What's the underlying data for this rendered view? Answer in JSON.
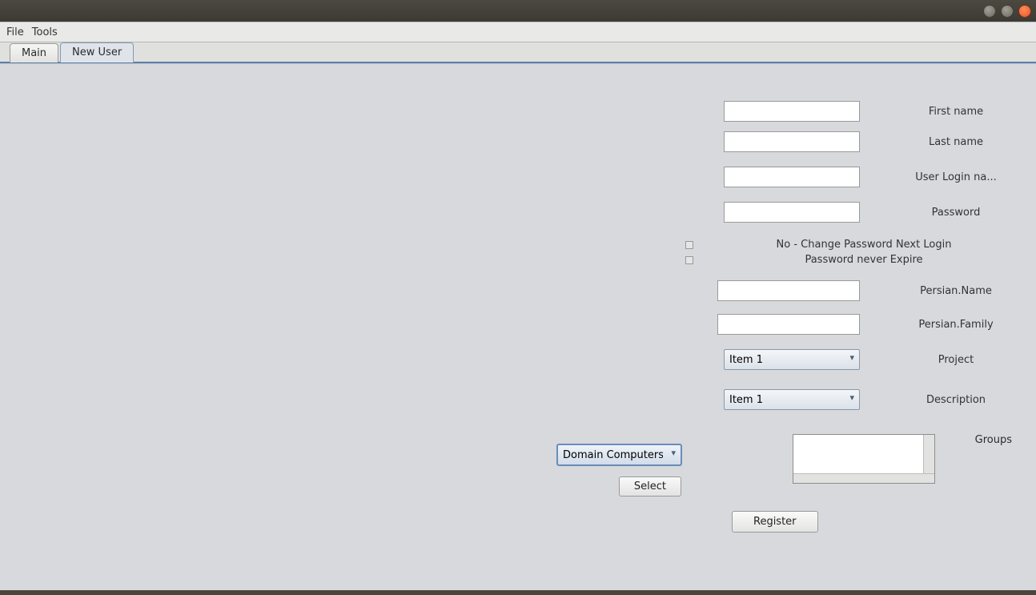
{
  "menubar": {
    "file": "File",
    "tools": "Tools"
  },
  "tabs": {
    "main": "Main",
    "new_user": "New User"
  },
  "form": {
    "first_name_label": "First name",
    "last_name_label": "Last name",
    "user_login_label": "User Login na...",
    "password_label": "Password",
    "check_no_change": "No - Change Password Next Login",
    "check_never_expire": "Password never Expire",
    "persian_name_label": "Persian.Name",
    "persian_family_label": "Persian.Family",
    "project_label": "Project",
    "description_label": "Description",
    "groups_label": "Groups",
    "project_value": "Item 1",
    "description_value": "Item 1",
    "domain_value": "Domain Computers",
    "select_btn": "Select",
    "register_btn": "Register",
    "first_name_value": "",
    "last_name_value": "",
    "user_login_value": "",
    "password_value": "",
    "persian_name_value": "",
    "persian_family_value": ""
  }
}
